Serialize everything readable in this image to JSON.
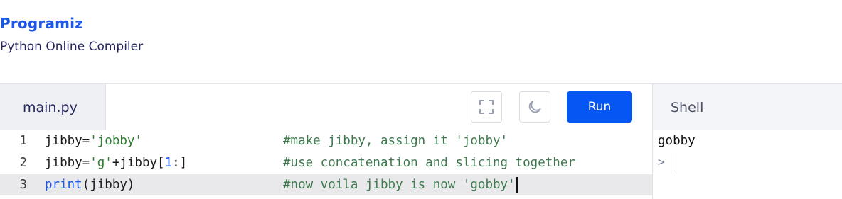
{
  "brand": {
    "logo": "Programiz",
    "subtitle": "Python Online Compiler"
  },
  "editor": {
    "tab_label": "main.py",
    "run_label": "Run",
    "lines": [
      {
        "num": "1",
        "code": [
          {
            "t": "jibby="
          },
          {
            "t": "'jobby'",
            "c": "str"
          }
        ],
        "comment": "#make jibby, assign it 'jobby'"
      },
      {
        "num": "2",
        "code": [
          {
            "t": "jibby="
          },
          {
            "t": "'g'",
            "c": "str"
          },
          {
            "t": "+jibby["
          },
          {
            "t": "1",
            "c": "num"
          },
          {
            "t": ":]"
          }
        ],
        "comment": "#use concatenation and slicing together"
      },
      {
        "num": "3",
        "code": [
          {
            "t": "print",
            "c": "kw"
          },
          {
            "t": "(jibby)"
          }
        ],
        "comment": "#now voila jibby is now 'gobby'"
      }
    ]
  },
  "shell": {
    "tab_label": "Shell",
    "output": "gobby",
    "prompt": ">"
  },
  "colors": {
    "accent": "#0556f3",
    "brand": "#1c57e8",
    "comment": "#3f7a4f",
    "string": "#2e7d32"
  },
  "icons": {
    "fullscreen": "fullscreen-icon",
    "theme": "moon-icon"
  }
}
